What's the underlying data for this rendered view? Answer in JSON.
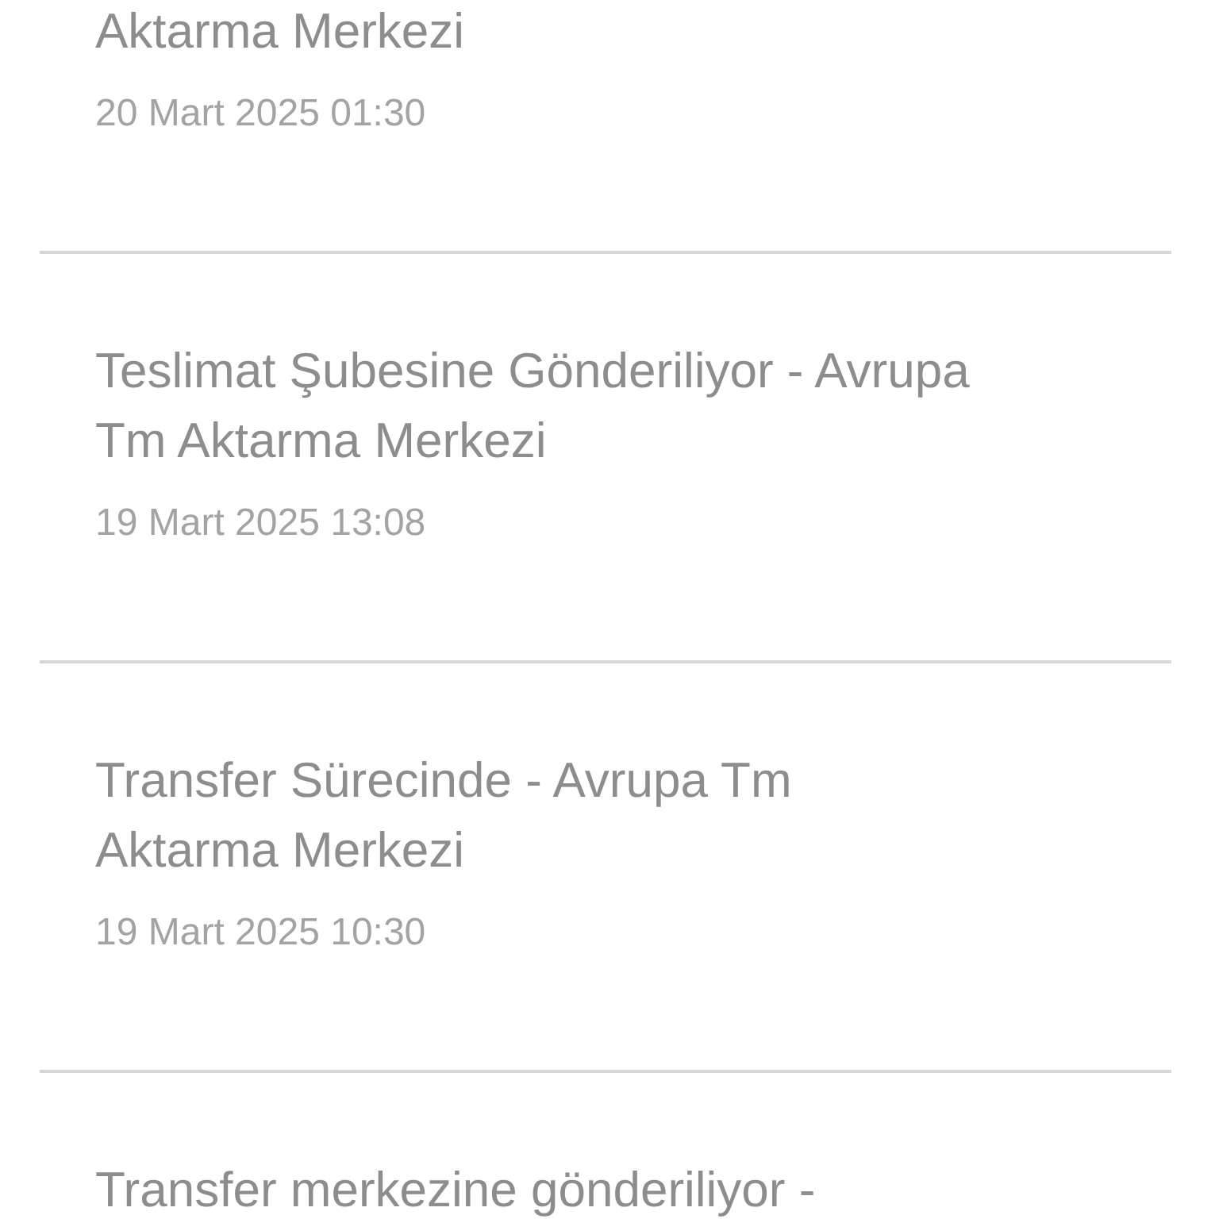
{
  "events": [
    {
      "title": "Aktarma Merkezi",
      "date": "20 Mart 2025 01:30"
    },
    {
      "title": "Teslimat Şubesine Gönderiliyor - Avrupa Tm Aktarma Merkezi",
      "date": "19 Mart 2025 13:08"
    },
    {
      "title": "Transfer Sürecinde - Avrupa Tm Aktarma Merkezi",
      "date": "19 Mart 2025 10:30"
    },
    {
      "title": "Transfer merkezine gönderiliyor -"
    }
  ]
}
